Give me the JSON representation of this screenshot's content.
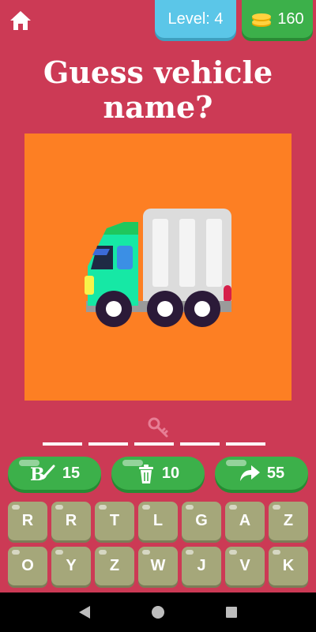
{
  "header": {
    "level_text": "Level: 4",
    "coins_text": "160"
  },
  "title": {
    "line1": "Guess vehicle",
    "line2": "name?"
  },
  "image": {
    "icon": "truck-icon",
    "background_color": "#fd7f23"
  },
  "answer": {
    "slot_count": 5
  },
  "helps": [
    {
      "icon": "brush-icon",
      "value": "15"
    },
    {
      "icon": "trash-icon",
      "value": "10"
    },
    {
      "icon": "share-icon",
      "value": "55"
    }
  ],
  "keyboard": {
    "rows": [
      [
        "R",
        "R",
        "T",
        "L",
        "G",
        "A",
        "Z"
      ],
      [
        "O",
        "Y",
        "Z",
        "W",
        "J",
        "V",
        "K"
      ]
    ]
  },
  "colors": {
    "background": "#cc3a55",
    "accent_green": "#3cb04a",
    "accent_blue": "#5bc6e8",
    "key_color": "#a5a77a"
  }
}
